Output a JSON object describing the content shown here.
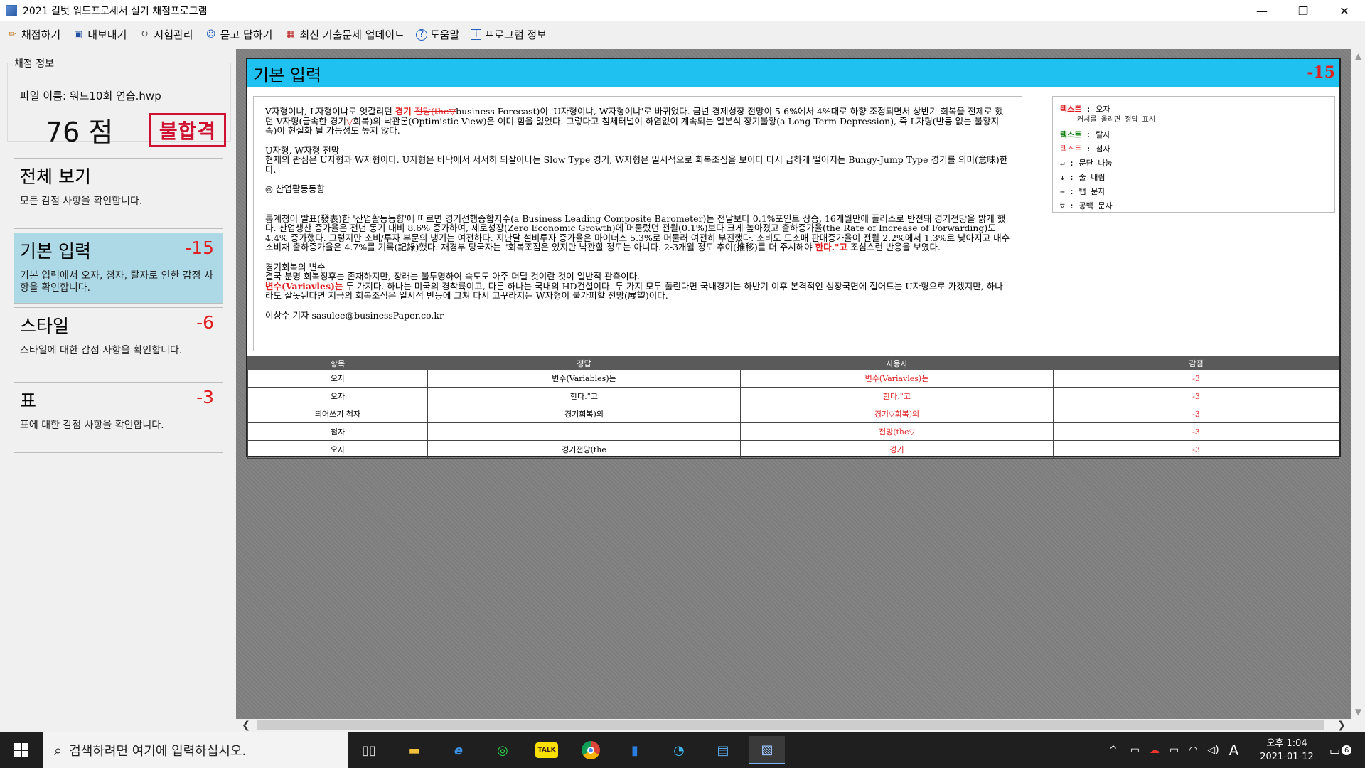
{
  "window": {
    "title": "2021 길벗 워드프로세서 실기 채점프로그램",
    "minimize": "—",
    "maximize": "❐",
    "close": "✕"
  },
  "menu": [
    {
      "label": "채점하기",
      "icon": "pencil-icon",
      "glyph": "✏"
    },
    {
      "label": "내보내기",
      "icon": "save-icon",
      "glyph": "▣"
    },
    {
      "label": "시험관리",
      "icon": "refresh-icon",
      "glyph": "↻"
    },
    {
      "label": "묻고 답하기",
      "icon": "people-icon",
      "glyph": "☺"
    },
    {
      "label": "최신 기출문제 업데이트",
      "icon": "gift-icon",
      "glyph": "▦"
    },
    {
      "label": "도움말",
      "icon": "help-icon",
      "glyph": "?"
    },
    {
      "label": "프로그램 정보",
      "icon": "info-icon",
      "glyph": "i"
    }
  ],
  "info": {
    "legend": "채점 정보",
    "file_name": "파일 이름: 워드10회 연습.hwp",
    "score": "76 점",
    "result": "불합격"
  },
  "categories": [
    {
      "name": "전체 보기",
      "points": "",
      "desc": "모든 감점 사항을 확인합니다."
    },
    {
      "name": "기본 입력",
      "points": "-15",
      "desc": "기본 입력에서 오자, 첨자, 탈자로 인한 감점 사항을 확인합니다."
    },
    {
      "name": "스타일",
      "points": "-6",
      "desc": "스타일에 대한 감점 사항을 확인합니다."
    },
    {
      "name": "표",
      "points": "-3",
      "desc": "표에 대한 감점 사항을 확인합니다."
    }
  ],
  "doc": {
    "title": "기본 입력",
    "points": "-15",
    "p1_a": "V자형이냐, L자형이냐로 엇갈리던 ",
    "p1_err1": "경기 ",
    "p1_err2": "전망(the▽",
    "p1_b": "business Forecast)이 'U자형이냐, W자형이냐'로 바뀌었다. 금년 경제성장 전망이 5-6%에서 4%대로 하향 조정되면서 상반기 회복을 전제로 했던 V자형(급속한 경기",
    "p1_err3": "▽",
    "p1_c": "회복)의 낙관론(Optimistic View)은 이미 힘을 잃었다. 그렇다고 침체터널이 하염없이 계속되는 일본식 장기불황(a Long Term Depression), 즉 L자형(반등 없는 불황지속)이 현실화 될 가능성도 높지 않다.",
    "p2_h": "U자형, W자형 전망",
    "p2": "현재의 관심은 U자형과 W자형이다. U자형은 바닥에서 서서히 되살아나는 Slow Type 경기, W자형은 일시적으로 회복조짐을 보이다 다시 급하게 떨어지는 Bungy-Jump Type 경기를 의미(意味)한다.",
    "p3_h": "◎ 산업활동동향",
    "p4_a": "통계청이 발표(發表)한 '산업활동동향'에 따르면 경기선행종합지수(a Business Leading Composite Barometer)는 전달보다 0.1%포인트 상승, 16개월만에 플러스로 반전돼 경기전망을 밝게 했다. 산업생산 증가율은 전년 동기 대비 8.6% 증가하여, 제로성장(Zero Economic Growth)에 머물렀던 전월(0.1%)보다 크게 높아졌고 출하증가율(the Rate of Increase of Forwarding)도 4.4% 증가했다. 그렇지만 소비/투자 부문의 냉기는 여전하다. 지난달 설비투자 증가율은 마이너스 5.3%로 머물러 여전히 부진했다. 소비도 도소매 판매증가율이 전월 2.2%에서 1.3%로 낮아지고 내수소비재 출하증가율은 4.7%를 기록(記錄)했다. 재경부 당국자는 \"회복조짐은 있지만 낙관할 정도는 아니다. 2-3개월 정도 추이(推移)를 더 주시해야 ",
    "p4_err": "한다.\"고",
    "p4_b": " 조심스런 반응을 보였다.",
    "p5_h": "경기회복의 변수",
    "p5_a": "결국 분명 회복징후는 존재하지만, 장래는 불투명하여 속도도 아주 더딜 것이란 것이 일반적 관측이다.",
    "p5_err": "변수(Variavles)는",
    "p5_b": " 두 가지다. 하나는 미국의 경착륙이고, 다른 하나는 국내의 HD건설이다. 두 가지 모두 풀린다면 국내경기는 하반기 이후 본격적인 성장국면에 접어드는 U자형으로 가겠지만, 하나라도 잘못된다면 지금의 회복조짐은 일시적 반등에 그쳐 다시 고꾸라지는 W자형이 불가피할 전망(展望)이다.",
    "p6": "이상수 기자 sasulee@businessPaper.co.kr"
  },
  "legend": {
    "l1_word": "텍스트",
    "l1_desc": " : 오자",
    "l1_sub": "커서를 올리면 정답 표시",
    "l2_word": "텍스트",
    "l2_desc": " : 탈자",
    "l3_word": "텍스트",
    "l3_desc": " : 첨자",
    "l4": "↵ : 문단 나눔",
    "l5": "↓ : 줄 내림",
    "l6": "→ : 탭 문자",
    "l7": "▽ : 공백 문자"
  },
  "table": {
    "headers": [
      "항목",
      "정답",
      "사용자",
      "감점"
    ],
    "rows": [
      [
        "오자",
        "변수(Variables)는",
        "변수(Variavles)는",
        "-3"
      ],
      [
        "오자",
        "한다.\"고",
        "한다.\"고",
        "-3"
      ],
      [
        "띄어쓰기 첨자",
        "경기회복)의",
        "경기▽회복)의",
        "-3"
      ],
      [
        "첨자",
        "",
        "전망(the▽",
        "-3"
      ],
      [
        "오자",
        "경기전망(the",
        "경기",
        "-3"
      ]
    ]
  },
  "taskbar": {
    "search_placeholder": "검색하려면 여기에 입력하십시오.",
    "time": "오후 1:04",
    "date": "2021-01-12",
    "ime": "A",
    "notifications": "6"
  }
}
